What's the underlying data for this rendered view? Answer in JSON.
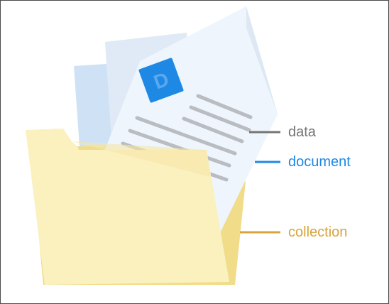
{
  "labels": {
    "data": "data",
    "document": "document",
    "collection": "collection"
  },
  "doc_badge_letter": "D",
  "colors": {
    "data": "#757575",
    "document": "#1e88e5",
    "collection": "#d9a43a",
    "folder": "#fbf1bf",
    "folder_shadow": "#f1dc8a",
    "paper": "#eef5fc",
    "paper_back": "#cfe2f5",
    "line": "#b9bcc0",
    "badge": "#1e88e5"
  }
}
